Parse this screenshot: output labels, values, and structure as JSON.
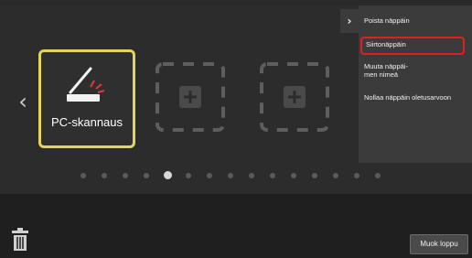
{
  "tiles": [
    {
      "label": "PC-skannaus",
      "icon": "scanner-icon"
    },
    {
      "label": "",
      "icon": "add-icon"
    },
    {
      "label": "",
      "icon": "add-icon"
    }
  ],
  "pager": {
    "count": 15,
    "active_index": 4
  },
  "menu": {
    "items": [
      {
        "label": "Poista näppäin"
      },
      {
        "label": "Siirtonäppäin"
      },
      {
        "label": "Muuta näppäi-\nmen nimeä"
      },
      {
        "label": "Nollaa näppäin oletusarvoon"
      }
    ],
    "selected_index": 1
  },
  "footer": {
    "done_label": "Muok loppu"
  },
  "colors": {
    "highlight": "#e6d35a",
    "selection_outline": "#e02020"
  }
}
